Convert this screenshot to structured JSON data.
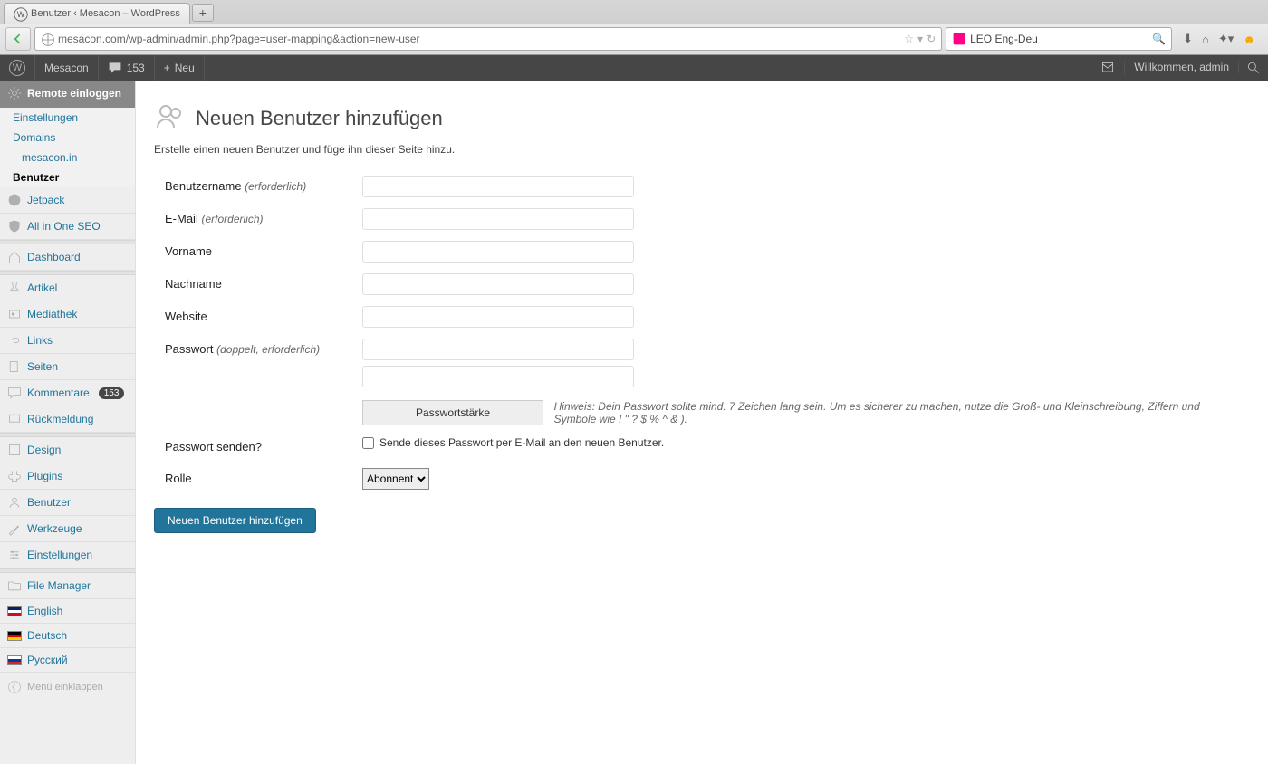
{
  "browser": {
    "tab_title": "Benutzer ‹ Mesacon – WordPress",
    "url": "mesacon.com/wp-admin/admin.php?page=user-mapping&action=new-user",
    "search_placeholder": "LEO Eng-Deu"
  },
  "adminbar": {
    "site": "Mesacon",
    "comment_count": "153",
    "new_label": "Neu",
    "howdy": "Willkommen, admin"
  },
  "sidebar": {
    "remote_login": "Remote einloggen",
    "submenu": {
      "settings": "Einstellungen",
      "domains": "Domains",
      "domain_item": "mesacon.in",
      "users": "Benutzer"
    },
    "items": {
      "jetpack": "Jetpack",
      "aioseo": "All in One SEO",
      "dashboard": "Dashboard",
      "posts": "Artikel",
      "media": "Mediathek",
      "links": "Links",
      "pages": "Seiten",
      "comments": "Kommentare",
      "comments_count": "153",
      "feedback": "Rückmeldung",
      "appearance": "Design",
      "plugins": "Plugins",
      "users": "Benutzer",
      "tools": "Werkzeuge",
      "settings2": "Einstellungen",
      "file_manager": "File Manager",
      "english": "English",
      "deutsch": "Deutsch",
      "russian": "Русский",
      "collapse": "Menü einklappen"
    }
  },
  "page": {
    "title": "Neuen Benutzer hinzufügen",
    "desc": "Erstelle einen neuen Benutzer und füge ihn dieser Seite hinzu.",
    "labels": {
      "username": "Benutzername",
      "required": "(erforderlich)",
      "email": "E-Mail",
      "firstname": "Vorname",
      "lastname": "Nachname",
      "website": "Website",
      "password": "Passwort",
      "password_req": "(doppelt, erforderlich)",
      "strength": "Passwortstärke",
      "hint": "Hinweis: Dein Passwort sollte mind. 7 Zeichen lang sein. Um es sicherer zu machen, nutze die Groß- und Kleinschreibung, Ziffern und Symbole wie ! \" ? $ % ^ & ).",
      "send_password_q": "Passwort senden?",
      "send_password_check": "Sende dieses Passwort per E-Mail an den neuen Benutzer.",
      "role": "Rolle",
      "role_selected": "Abonnent",
      "submit": "Neuen Benutzer hinzufügen"
    }
  }
}
